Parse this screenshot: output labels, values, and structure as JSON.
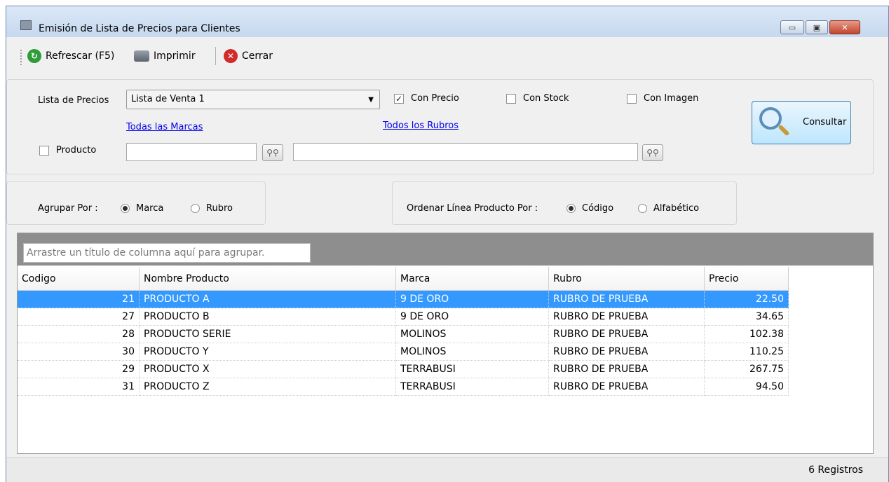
{
  "window": {
    "title": "Emisión de Lista de Precios para Clientes",
    "controls": {
      "minimize": "▭",
      "maximize": "▣",
      "close": "✕"
    }
  },
  "toolbar": {
    "refresh_label": "Refrescar (F5)",
    "print_label": "Imprimir",
    "close_label": "Cerrar"
  },
  "filters": {
    "price_list_label": "Lista de Precios",
    "price_list_value": "Lista de Venta 1",
    "con_precio_label": "Con Precio",
    "con_precio_checked": true,
    "con_stock_label": "Con Stock",
    "con_stock_checked": false,
    "con_imagen_label": "Con Imagen",
    "con_imagen_checked": false,
    "brands_link": "Todas las Marcas",
    "categories_link": "Todos los Rubros",
    "product_label": "Producto",
    "product_checked": false,
    "product_code_value": "",
    "product_desc_value": "",
    "consult_label": "Consultar"
  },
  "grouping": {
    "label": "Agrupar Por :",
    "options": [
      "Marca",
      "Rubro"
    ],
    "selected": "Marca"
  },
  "ordering": {
    "label": "Ordenar Línea Producto Por :",
    "options": [
      "Código",
      "Alfabético"
    ],
    "selected": "Código"
  },
  "grid": {
    "group_hint": "Arrastre un título de columna aquí para agrupar.",
    "columns": [
      "Codigo",
      "Nombre Producto",
      "Marca",
      "Rubro",
      "Precio"
    ],
    "selected_row": 0,
    "rows": [
      {
        "codigo": "21",
        "nombre": "PRODUCTO A",
        "marca": "9 DE ORO",
        "rubro": "RUBRO DE PRUEBA",
        "precio": "22.50"
      },
      {
        "codigo": "27",
        "nombre": "PRODUCTO B",
        "marca": "9 DE ORO",
        "rubro": "RUBRO DE PRUEBA",
        "precio": "34.65"
      },
      {
        "codigo": "28",
        "nombre": "PRODUCTO SERIE",
        "marca": "MOLINOS",
        "rubro": "RUBRO DE PRUEBA",
        "precio": "102.38"
      },
      {
        "codigo": "30",
        "nombre": "PRODUCTO Y",
        "marca": "MOLINOS",
        "rubro": "RUBRO DE PRUEBA",
        "precio": "110.25"
      },
      {
        "codigo": "29",
        "nombre": "PRODUCTO X",
        "marca": "TERRABUSI",
        "rubro": "RUBRO DE PRUEBA",
        "precio": "267.75"
      },
      {
        "codigo": "31",
        "nombre": "PRODUCTO Z",
        "marca": "TERRABUSI",
        "rubro": "RUBRO DE PRUEBA",
        "precio": "94.50"
      }
    ]
  },
  "status": {
    "records": "6 Registros"
  },
  "colors": {
    "selection": "#3399ff",
    "link": "#0000ee",
    "group_bar": "#8e8e8e"
  }
}
